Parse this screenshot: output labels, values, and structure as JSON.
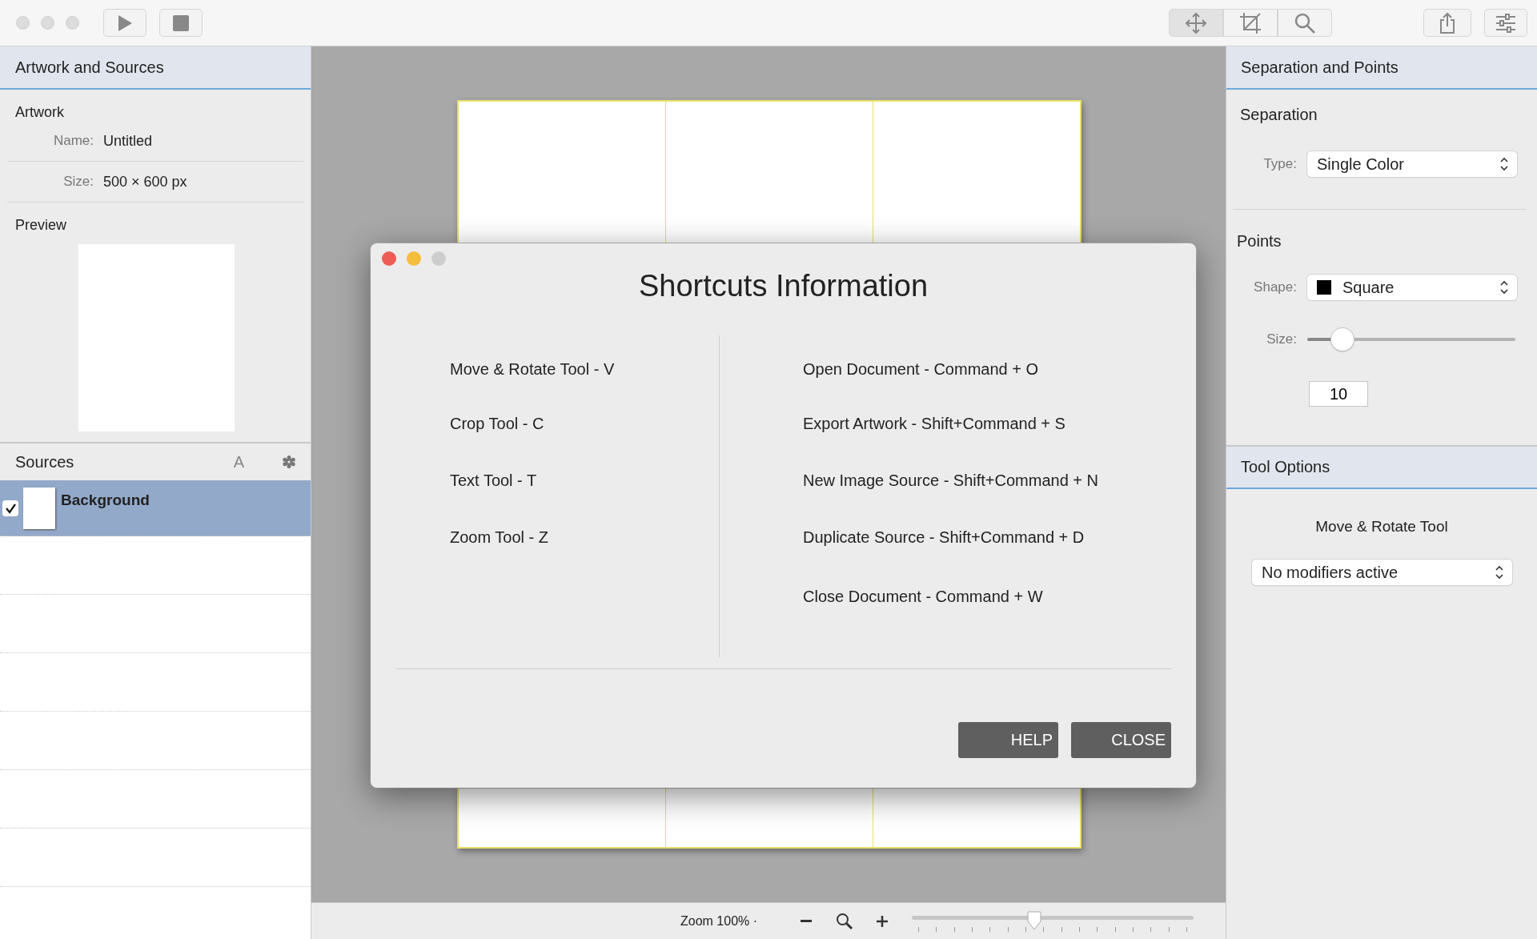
{
  "left_panel": {
    "title": "Artwork and Sources",
    "artwork": {
      "heading": "Artwork",
      "fields": [
        {
          "label": "Name:",
          "value": "Untitled"
        },
        {
          "label": "Size:",
          "value": "500 × 600 px"
        }
      ]
    },
    "preview": {
      "heading": "Preview"
    },
    "sources": {
      "heading": "Sources",
      "sort_label": "A",
      "items": [
        {
          "name": "Background",
          "checked": true,
          "selected": true
        }
      ]
    }
  },
  "right_panel": {
    "title": "Separation and Points",
    "separation": {
      "heading": "Separation",
      "type_label": "Type:",
      "type_value": "Single Color"
    },
    "points": {
      "heading": "Points",
      "shape_label": "Shape:",
      "shape_value": "Square",
      "size_label": "Size:",
      "size_slider": {
        "level": 0.13
      },
      "size_value": "10"
    },
    "tool_options": {
      "title": "Tool Options",
      "tool_name": "Move & Rotate Tool",
      "modifiers": "No modifiers active"
    }
  },
  "dialog": {
    "title": "Shortcuts Information",
    "left_shortcuts": [
      "Move & Rotate Tool - V",
      "Crop Tool - C",
      "Text Tool - T",
      "Zoom Tool - Z"
    ],
    "right_shortcuts": [
      "Open Document - Command + O",
      "Export Artwork - Shift+Command + S",
      "New Image Source - Shift+Command + N",
      "Duplicate Source - Shift+Command + D",
      "Close Document - Command + W"
    ],
    "buttons": [
      "HELP",
      "CLOSE"
    ]
  },
  "status_bar": {
    "zoom_label": "Zoom 100% ·",
    "zoom_slider": {
      "level": 0.43
    }
  }
}
